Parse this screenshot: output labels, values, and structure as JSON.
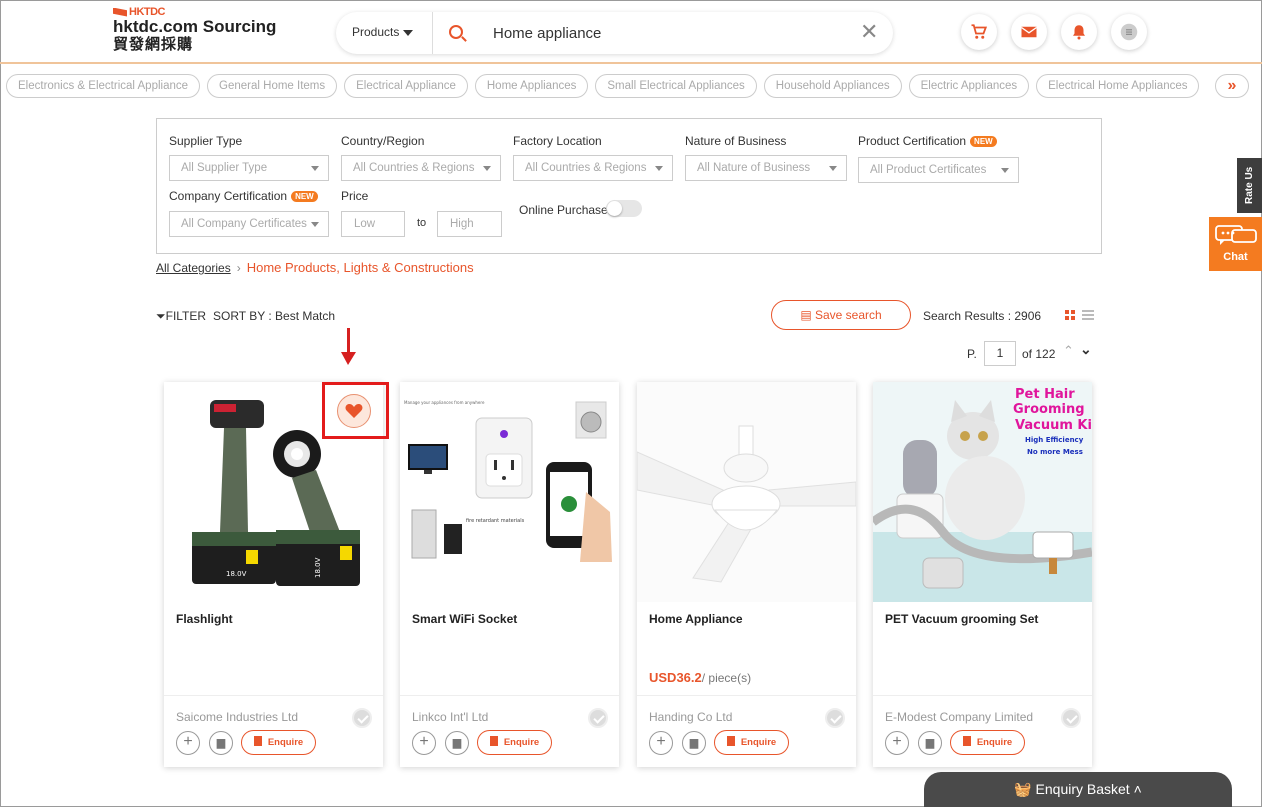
{
  "header": {
    "logo_small": "HKTDC",
    "logo_main": "hktdc.com Sourcing",
    "logo_zh": "貿發網採購",
    "search_category": "Products",
    "search_value": "Home appliance"
  },
  "categories": [
    "Electronics & Electrical Appliance",
    "General Home Items",
    "Electrical Appliance",
    "Home Appliances",
    "Small Electrical Appliances",
    "Household Appliances",
    "Electric Appliances",
    "Electrical Home Appliances"
  ],
  "filters": {
    "supplier_type": {
      "label": "Supplier Type",
      "value": "All Supplier Type"
    },
    "country": {
      "label": "Country/Region",
      "value": "All Countries & Regions"
    },
    "factory": {
      "label": "Factory Location",
      "value": "All Countries & Regions"
    },
    "nature": {
      "label": "Nature of Business",
      "value": "All Nature of Business"
    },
    "product_cert": {
      "label": "Product Certification",
      "value": "All Product Certificates"
    },
    "company_cert": {
      "label": "Company Certification",
      "value": "All Company Certificates"
    },
    "price": {
      "label": "Price",
      "low": "Low",
      "to": "to",
      "high": "High"
    },
    "online_purchase": "Online Purchase",
    "new_badge": "NEW"
  },
  "breadcrumb": {
    "root": "All Categories",
    "current": "Home Products, Lights & Constructions"
  },
  "toolbar": {
    "filter": "FILTER",
    "sort": "SORT BY : Best Match",
    "save_search": "Save search",
    "results": "Search Results : 2906",
    "page_prefix": "P.",
    "page": "1",
    "page_of": "of 122"
  },
  "products": [
    {
      "name": "Flashlight",
      "price": "",
      "unit": "",
      "supplier": "Saicome Industries Ltd",
      "enquire": "Enquire"
    },
    {
      "name": "Smart WiFi Socket",
      "price": "",
      "unit": "",
      "supplier": "Linkco Int'l Ltd",
      "enquire": "Enquire"
    },
    {
      "name": "Home Appliance",
      "price": "USD36.2",
      "unit": "/ piece(s)",
      "supplier": "Handing Co Ltd",
      "enquire": "Enquire"
    },
    {
      "name": "PET Vacuum grooming Set",
      "price": "",
      "unit": "",
      "supplier": "E-Modest Company Limited",
      "enquire": "Enquire"
    }
  ],
  "pet_ad": {
    "line1": "Pet Hair",
    "line2": "Grooming",
    "line3": "Vacuum Kit",
    "line4": "High Efficiency",
    "line5": "No more Mess"
  },
  "socket_ad": {
    "top": "Manage your appliances from anywhere",
    "caption": "fire retardant materials"
  },
  "flashlight_labels": {
    "a": "18.0V",
    "b": "18.0V"
  },
  "side": {
    "rate_us": "Rate Us",
    "chat": "Chat"
  },
  "basket": "Enquiry Basket",
  "colors": {
    "accent": "#e8552b",
    "highlight": "#e31b1b"
  }
}
